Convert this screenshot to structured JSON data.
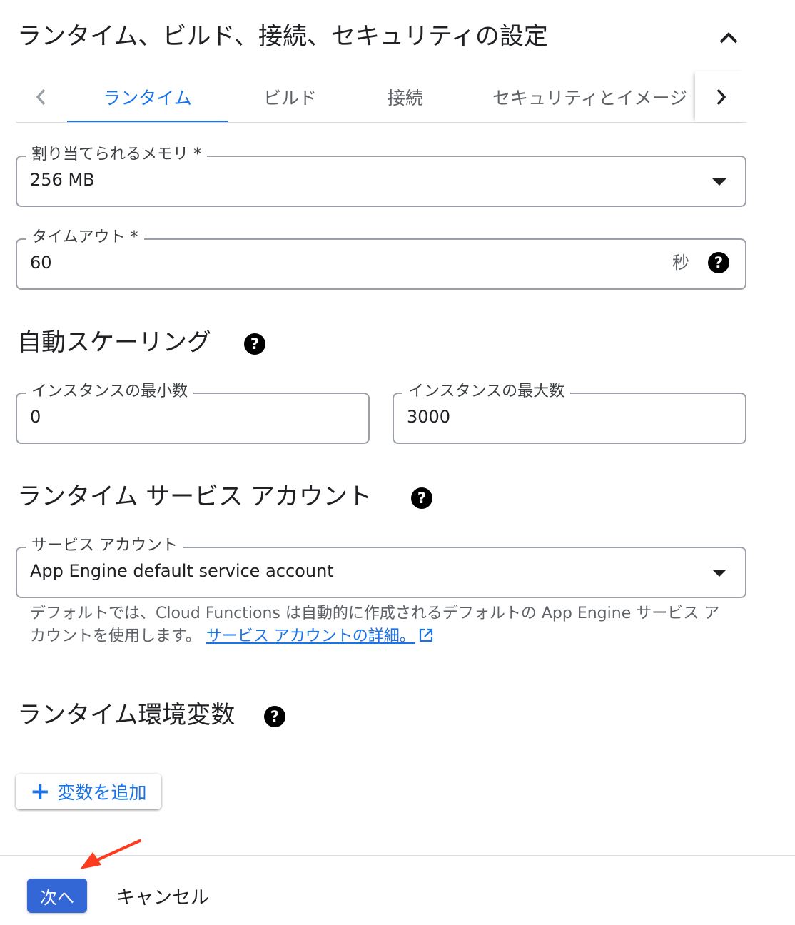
{
  "section": {
    "title": "ランタイム、ビルド、接続、セキュリティの設定"
  },
  "tabs": {
    "items": [
      {
        "label": "ランタイム",
        "active": true
      },
      {
        "label": "ビルド",
        "active": false
      },
      {
        "label": "接続",
        "active": false
      },
      {
        "label": "セキュリティとイメージ",
        "active": false
      }
    ]
  },
  "memory": {
    "label": "割り当てられるメモリ *",
    "value": "256 MB"
  },
  "timeout": {
    "label": "タイムアウト *",
    "value": "60",
    "suffix": "秒"
  },
  "autoscaling": {
    "heading": "自動スケーリング",
    "min_label": "インスタンスの最小数",
    "min_value": "0",
    "max_label": "インスタンスの最大数",
    "max_value": "3000"
  },
  "service_account": {
    "heading": "ランタイム サービス アカウント",
    "label": "サービス アカウント",
    "value": "App Engine default service account",
    "hint": "デフォルトでは、Cloud Functions は自動的に作成されるデフォルトの App Engine サービス アカウントを使用します。",
    "link": "サービス アカウントの詳細。"
  },
  "env_vars": {
    "heading": "ランタイム環境変数",
    "add_button": "変数を追加"
  },
  "footer": {
    "next": "次へ",
    "cancel": "キャンセル"
  },
  "colors": {
    "accent": "#1a73e8",
    "primary_button": "#3367d6",
    "annotation_arrow": "#ff3b1f"
  }
}
